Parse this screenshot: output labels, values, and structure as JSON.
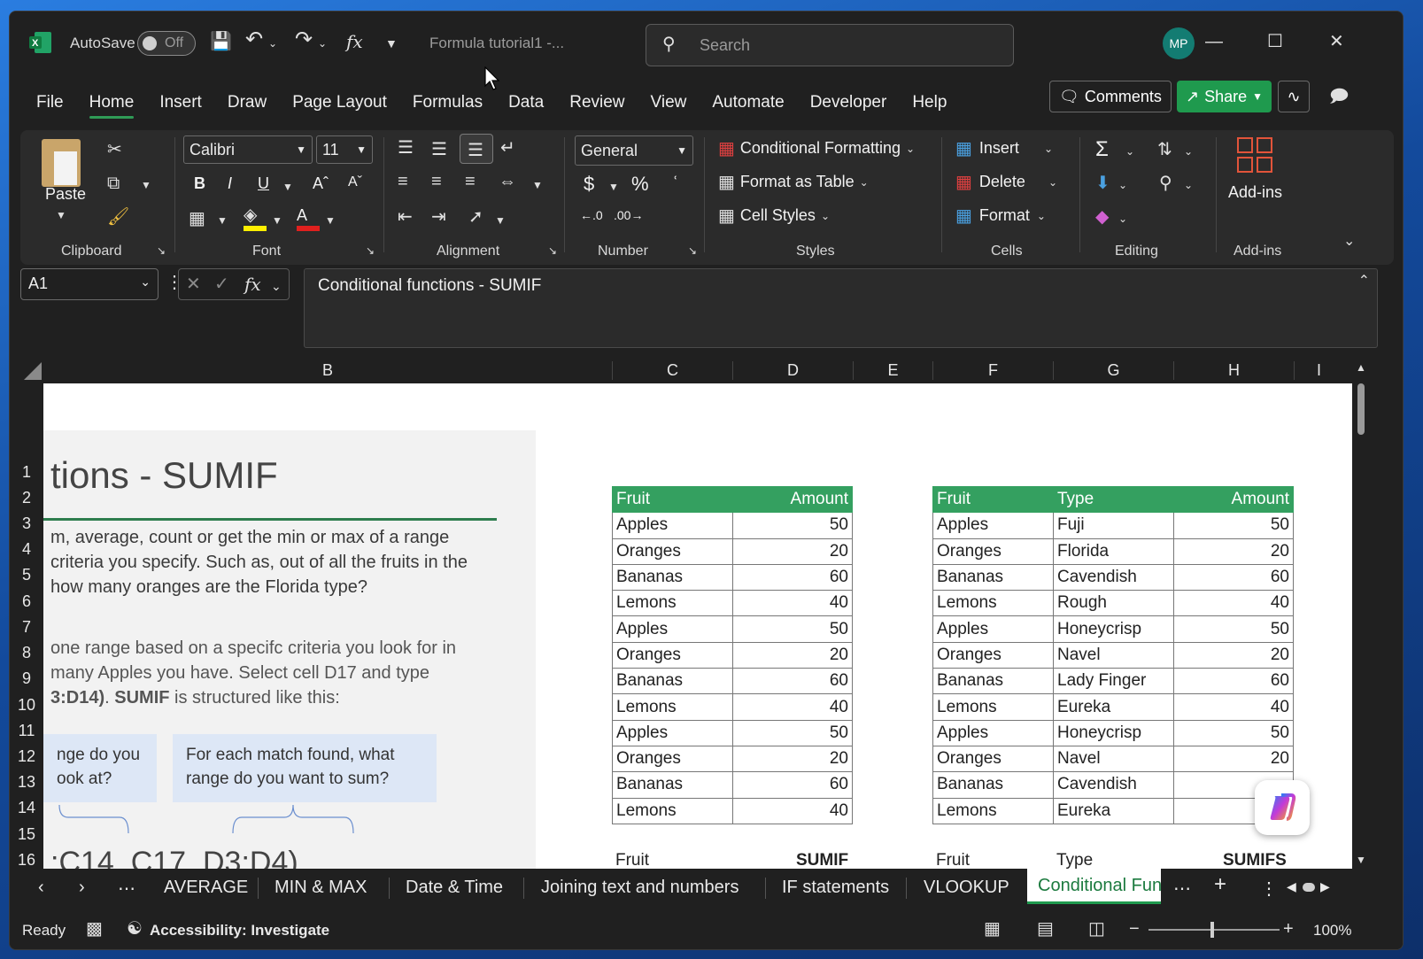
{
  "titlebar": {
    "autosave_label": "AutoSave",
    "autosave_state": "Off",
    "doc_title": "Formula tutorial1  -...",
    "search_placeholder": "Search",
    "avatar_initials": "MP"
  },
  "menu": {
    "items": [
      "File",
      "Home",
      "Insert",
      "Draw",
      "Page Layout",
      "Formulas",
      "Data",
      "Review",
      "View",
      "Automate",
      "Developer",
      "Help"
    ],
    "comments": "Comments",
    "share": "Share"
  },
  "ribbon": {
    "clipboard": {
      "paste": "Paste",
      "label": "Clipboard"
    },
    "font": {
      "family": "Calibri",
      "size": "11",
      "label": "Font"
    },
    "alignment": {
      "label": "Alignment"
    },
    "number": {
      "format": "General",
      "label": "Number"
    },
    "styles": {
      "conditional": "Conditional Formatting",
      "format_table": "Format as Table",
      "cell_styles": "Cell Styles",
      "label": "Styles"
    },
    "cells": {
      "insert": "Insert",
      "delete": "Delete",
      "format": "Format",
      "label": "Cells"
    },
    "editing": {
      "label": "Editing"
    },
    "addins": {
      "button": "Add-ins",
      "label": "Add-ins"
    }
  },
  "formula_bar": {
    "name_box": "A1",
    "content": "Conditional functions - SUMIF"
  },
  "columns": [
    "B",
    "C",
    "D",
    "E",
    "F",
    "G",
    "H",
    "I"
  ],
  "rows": [
    "1",
    "2",
    "3",
    "4",
    "5",
    "6",
    "7",
    "8",
    "9",
    "10",
    "11",
    "12",
    "13",
    "14",
    "15",
    "16"
  ],
  "sheet": {
    "title": "tions - SUMIF",
    "para1": [
      "m, average, count or get the min or max of a range",
      "criteria you specify. Such as, out of all the fruits in the",
      "how many oranges are the Florida type?"
    ],
    "para2": [
      "one range based on a specifc criteria you look for in",
      " many Apples you have. Select cell D17 and type"
    ],
    "para2_bold1": "3:D14)",
    "para2_mid": ". ",
    "para2_bold2": "SUMIF",
    "para2_end": " is structured like this:",
    "note1": [
      "nge do you",
      "ook at?"
    ],
    "note2": [
      "For each match found, what",
      "range do you want to sum?"
    ],
    "formula_preview": ":C14, C17, D3:D4)",
    "table1": {
      "headers": [
        "Fruit",
        "Amount"
      ],
      "rows": [
        [
          "Apples",
          "50"
        ],
        [
          "Oranges",
          "20"
        ],
        [
          "Bananas",
          "60"
        ],
        [
          "Lemons",
          "40"
        ],
        [
          "Apples",
          "50"
        ],
        [
          "Oranges",
          "20"
        ],
        [
          "Bananas",
          "60"
        ],
        [
          "Lemons",
          "40"
        ],
        [
          "Apples",
          "50"
        ],
        [
          "Oranges",
          "20"
        ],
        [
          "Bananas",
          "60"
        ],
        [
          "Lemons",
          "40"
        ]
      ]
    },
    "table2": {
      "headers": [
        "Fruit",
        "Type",
        "Amount"
      ],
      "rows": [
        [
          "Apples",
          "Fuji",
          "50"
        ],
        [
          "Oranges",
          "Florida",
          "20"
        ],
        [
          "Bananas",
          "Cavendish",
          "60"
        ],
        [
          "Lemons",
          "Rough",
          "40"
        ],
        [
          "Apples",
          "Honeycrisp",
          "50"
        ],
        [
          "Oranges",
          "Navel",
          "20"
        ],
        [
          "Bananas",
          "Lady Finger",
          "60"
        ],
        [
          "Lemons",
          "Eureka",
          "40"
        ],
        [
          "Apples",
          "Honeycrisp",
          "50"
        ],
        [
          "Oranges",
          "Navel",
          "20"
        ],
        [
          "Bananas",
          "Cavendish",
          ""
        ],
        [
          "Lemons",
          "Eureka",
          ""
        ]
      ]
    },
    "row16": {
      "c": "Fruit",
      "d": "SUMIF",
      "f": "Fruit",
      "g": "Type",
      "h": "SUMIFS"
    }
  },
  "tabs": {
    "items": [
      "AVERAGE",
      "MIN & MAX",
      "Date & Time",
      "Joining text and numbers",
      "IF statements",
      "VLOOKUP"
    ],
    "active": "Conditional Fun"
  },
  "status": {
    "ready": "Ready",
    "accessibility": "Accessibility: Investigate",
    "zoom": "100%"
  }
}
